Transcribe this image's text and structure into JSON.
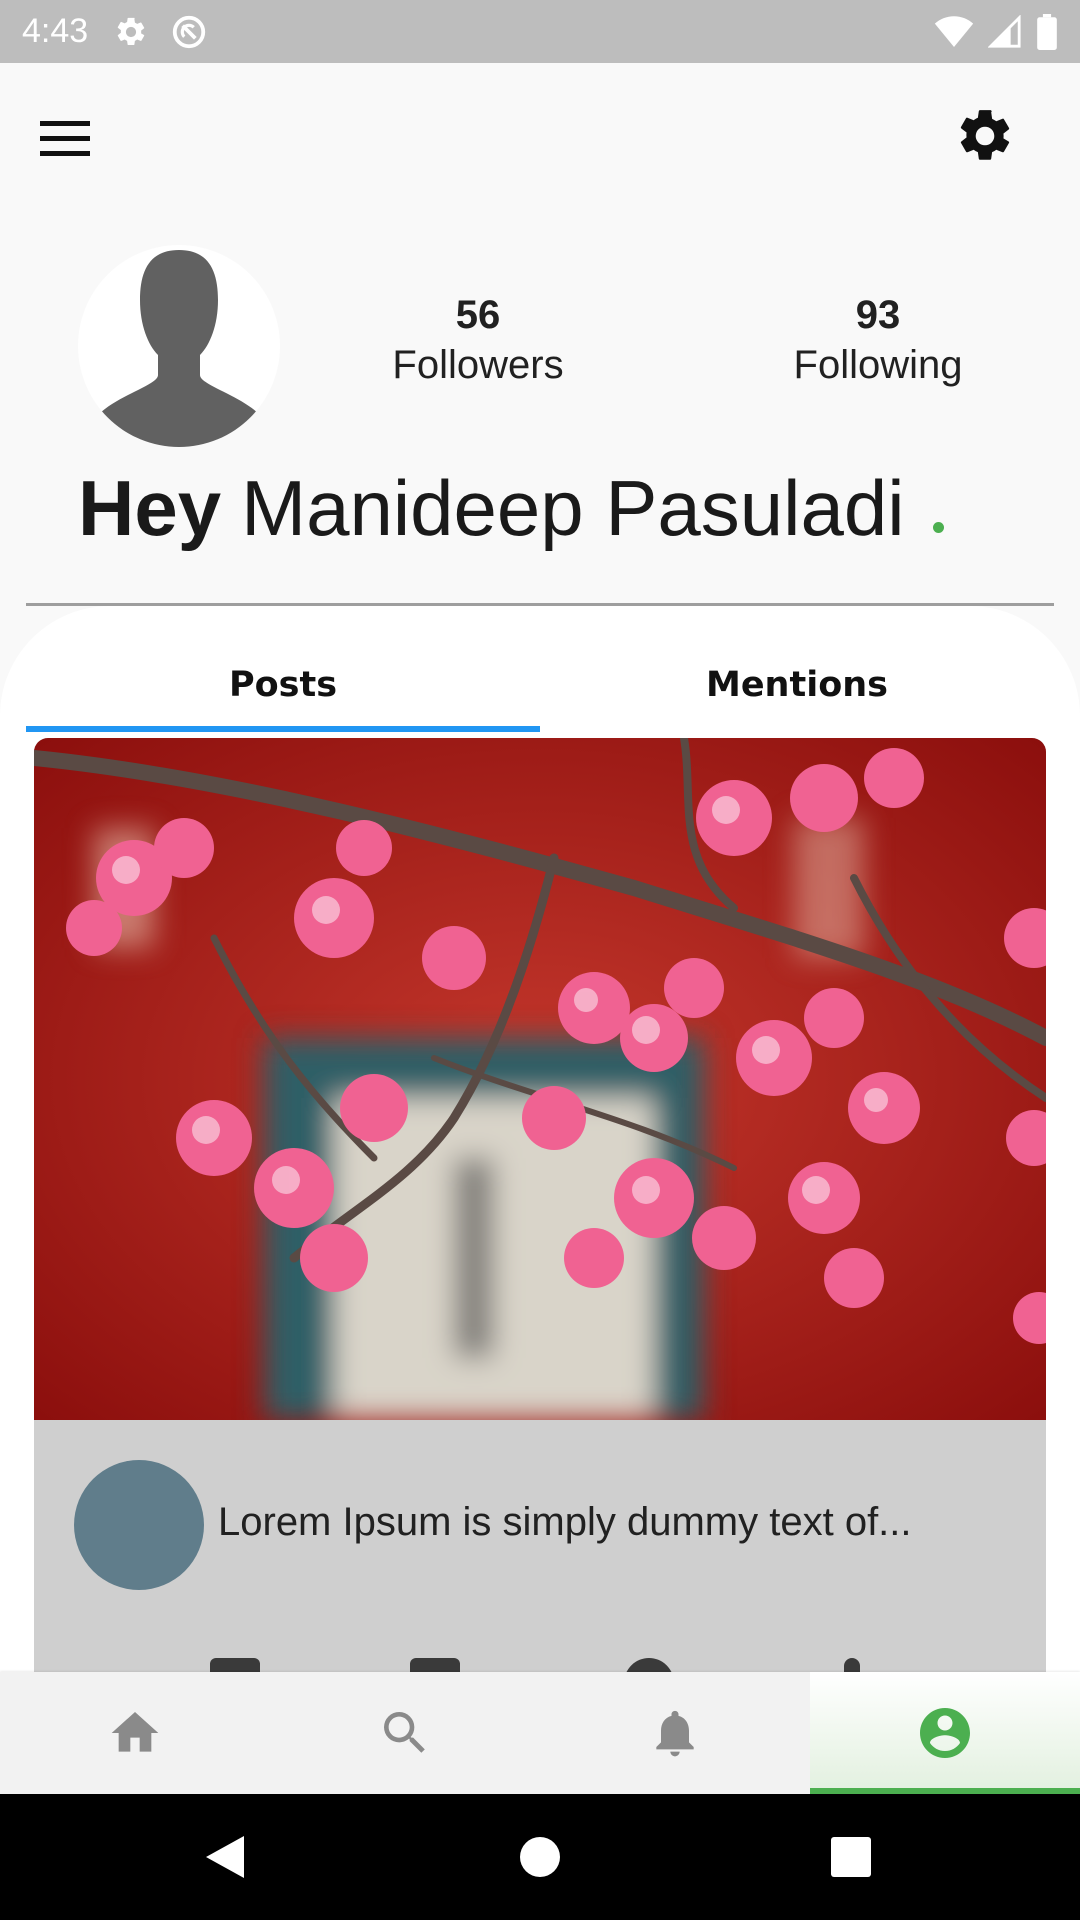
{
  "status_bar": {
    "time": "4:43",
    "icons": [
      "gear-icon",
      "sync-disabled-icon",
      "wifi-icon",
      "signal-icon",
      "battery-icon"
    ]
  },
  "app_bar": {
    "left_icon": "menu-icon",
    "right_icon": "gear-icon"
  },
  "profile": {
    "avatar_icon": "person-silhouette-icon",
    "followers_count": "56",
    "followers_label": "Followers",
    "following_count": "93",
    "following_label": "Following",
    "greeting_prefix": "Hey",
    "name": "Manideep Pasuladi",
    "online_color": "#4caf50"
  },
  "tabs": [
    {
      "label": "Posts",
      "selected": true
    },
    {
      "label": "Mentions",
      "selected": false
    }
  ],
  "post": {
    "image_subject": "pink-cherry-blossom-branches-on-red-background",
    "excerpt": "Lorem Ipsum is simply dummy text of...",
    "author_avatar_color": "#607d8b"
  },
  "bottom_nav": [
    {
      "icon": "home-icon",
      "active": false
    },
    {
      "icon": "search-icon",
      "active": false
    },
    {
      "icon": "bell-icon",
      "active": false
    },
    {
      "icon": "account-circle-icon",
      "active": true
    }
  ],
  "colors": {
    "accent_blue": "#2196f3",
    "accent_green": "#4caf50",
    "inactive_icon": "#8a8a8a"
  }
}
